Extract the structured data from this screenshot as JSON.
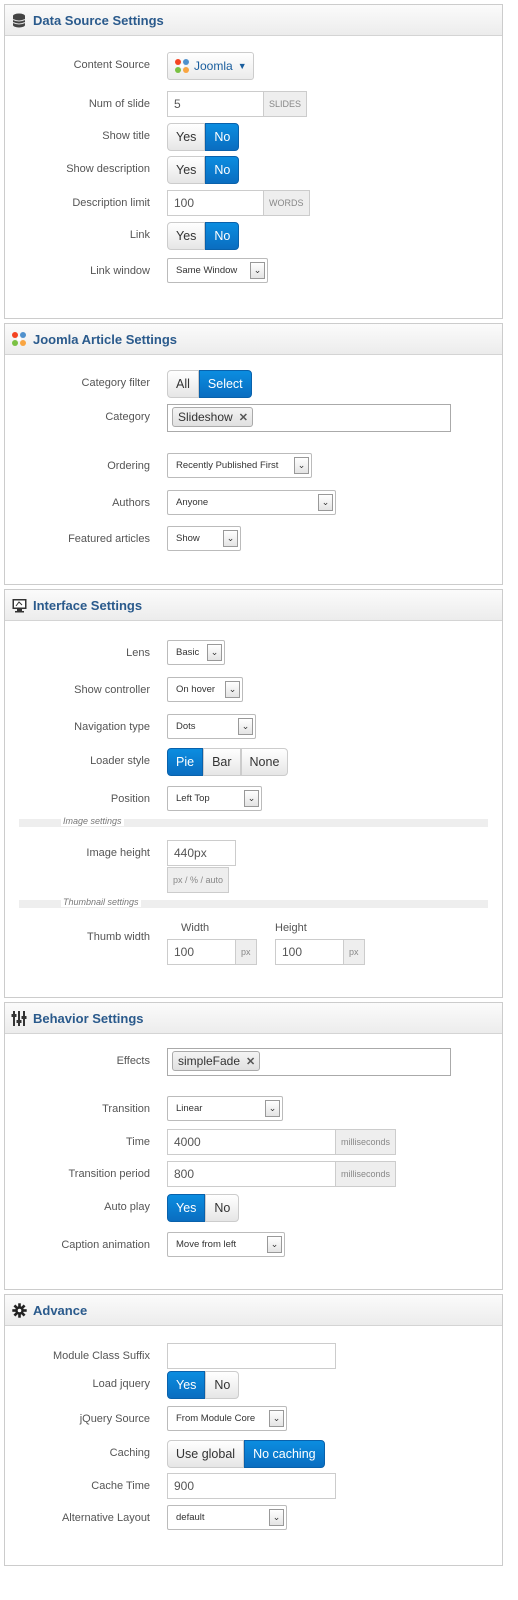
{
  "data_source": {
    "title": "Data Source Settings",
    "content_source": {
      "label": "Content Source",
      "value": "Joomla"
    },
    "num_slide": {
      "label": "Num of slide",
      "value": "5",
      "unit": "SLIDES"
    },
    "show_title": {
      "label": "Show title",
      "yes": "Yes",
      "no": "No"
    },
    "show_description": {
      "label": "Show description",
      "yes": "Yes",
      "no": "No"
    },
    "description_limit": {
      "label": "Description limit",
      "value": "100",
      "unit": "WORDS"
    },
    "link": {
      "label": "Link",
      "yes": "Yes",
      "no": "No"
    },
    "link_window": {
      "label": "Link window",
      "value": "Same Window"
    }
  },
  "joomla_article": {
    "title": "Joomla Article Settings",
    "category_filter": {
      "label": "Category filter",
      "all": "All",
      "select": "Select"
    },
    "category": {
      "label": "Category",
      "tag": "Slideshow"
    },
    "ordering": {
      "label": "Ordering",
      "value": "Recently Published First"
    },
    "authors": {
      "label": "Authors",
      "value": "Anyone"
    },
    "featured": {
      "label": "Featured articles",
      "value": "Show"
    }
  },
  "interface": {
    "title": "Interface Settings",
    "lens": {
      "label": "Lens",
      "value": "Basic"
    },
    "show_controller": {
      "label": "Show controller",
      "value": "On hover"
    },
    "navigation_type": {
      "label": "Navigation type",
      "value": "Dots"
    },
    "loader_style": {
      "label": "Loader style",
      "options": [
        "Pie",
        "Bar",
        "None"
      ]
    },
    "position": {
      "label": "Position",
      "value": "Left Top"
    },
    "image_settings": "Image settings",
    "image_height": {
      "label": "Image height",
      "value": "440px",
      "hint": "px / % / auto"
    },
    "thumbnail_settings": "Thumbnail settings",
    "thumb": {
      "label": "Thumb width",
      "width_label": "Width",
      "height_label": "Height",
      "width": "100",
      "height": "100",
      "unit": "px"
    }
  },
  "behavior": {
    "title": "Behavior Settings",
    "effects": {
      "label": "Effects",
      "tag": "simpleFade"
    },
    "transition": {
      "label": "Transition",
      "value": "Linear"
    },
    "time": {
      "label": "Time",
      "value": "4000",
      "unit": "milliseconds"
    },
    "transition_period": {
      "label": "Transition period",
      "value": "800",
      "unit": "milliseconds"
    },
    "auto_play": {
      "label": "Auto play",
      "yes": "Yes",
      "no": "No"
    },
    "caption_animation": {
      "label": "Caption animation",
      "value": "Move from left"
    }
  },
  "advance": {
    "title": "Advance",
    "module_class_suffix": {
      "label": "Module Class Suffix",
      "value": ""
    },
    "load_jquery": {
      "label": "Load jquery",
      "yes": "Yes",
      "no": "No"
    },
    "jquery_source": {
      "label": "jQuery Source",
      "value": "From Module Core"
    },
    "caching": {
      "label": "Caching",
      "use_global": "Use global",
      "no_caching": "No caching"
    },
    "cache_time": {
      "label": "Cache Time",
      "value": "900"
    },
    "alternative_layout": {
      "label": "Alternative Layout",
      "value": "default"
    }
  },
  "colors": {
    "active": "#0a7dd4",
    "title": "#2a5a8c"
  }
}
